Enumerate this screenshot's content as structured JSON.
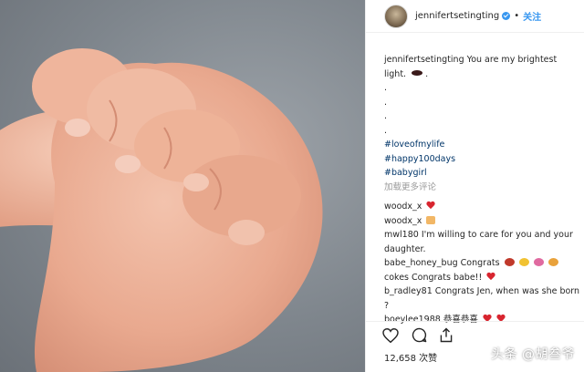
{
  "post": {
    "username": "jennifertsetingting",
    "dot": "•",
    "follow_label": "关注",
    "caption_user": "jennifertsetingting",
    "caption_text": "You are my brightest light.",
    "caption_end": ".",
    "dots": [
      ".",
      ".",
      ".",
      ".",
      "."
    ],
    "hashtags": [
      "#loveofmylife",
      "#happy100days",
      "#babygirl"
    ],
    "load_more": "加载更多评论",
    "comments": [
      {
        "user": "woodx_x",
        "text": ""
      },
      {
        "user": "woodx_x",
        "text": ""
      },
      {
        "user": "mwl180",
        "text": "I'm willing to care for you and your daughter."
      },
      {
        "user": "babe_honey_bug",
        "text": "Congrats"
      },
      {
        "user": "cokes",
        "text": "Congrats babe!!"
      },
      {
        "user": "b_radley81",
        "text": "Congrats Jen, when was she born ?"
      },
      {
        "user": "boeylee1988",
        "text": "恭喜恭喜"
      }
    ],
    "likes": "12,658 次赞"
  },
  "icons": [
    "verified-icon",
    "heart-outline-icon",
    "comment-icon",
    "share-icon",
    "heart-emoji-icon",
    "thumbs-up-icon",
    "lips-emoji-icon"
  ],
  "colors": {
    "link": "#3897f0",
    "hashtag": "#003569",
    "muted": "#999999",
    "heart": "#d8252f"
  },
  "watermark": "头条 @胡叁爷"
}
